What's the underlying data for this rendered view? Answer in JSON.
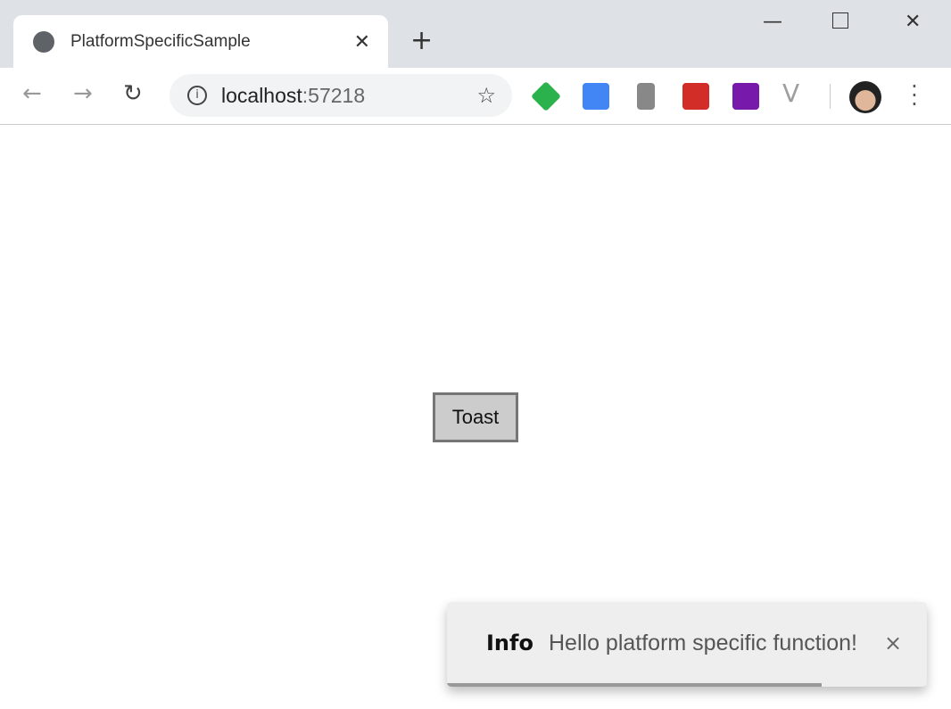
{
  "browser": {
    "tab_title": "PlatformSpecificSample",
    "url_host": "localhost",
    "url_port": ":57218",
    "extensions": [
      {
        "name": "feedly-icon",
        "color": "#2bb24c"
      },
      {
        "name": "google-translate-icon",
        "color": "#4285f4"
      },
      {
        "name": "office-icon",
        "color": "#888888"
      },
      {
        "name": "lastpass-icon",
        "color": "#d32d27"
      },
      {
        "name": "onenote-icon",
        "color": "#7719aa"
      },
      {
        "name": "vue-devtools-icon",
        "color": "#9e9e9e"
      }
    ]
  },
  "page": {
    "toast_button_label": "Toast"
  },
  "toast": {
    "label": "Info",
    "message": "Hello platform specific function!",
    "close": "×",
    "progress_percent": 78
  }
}
